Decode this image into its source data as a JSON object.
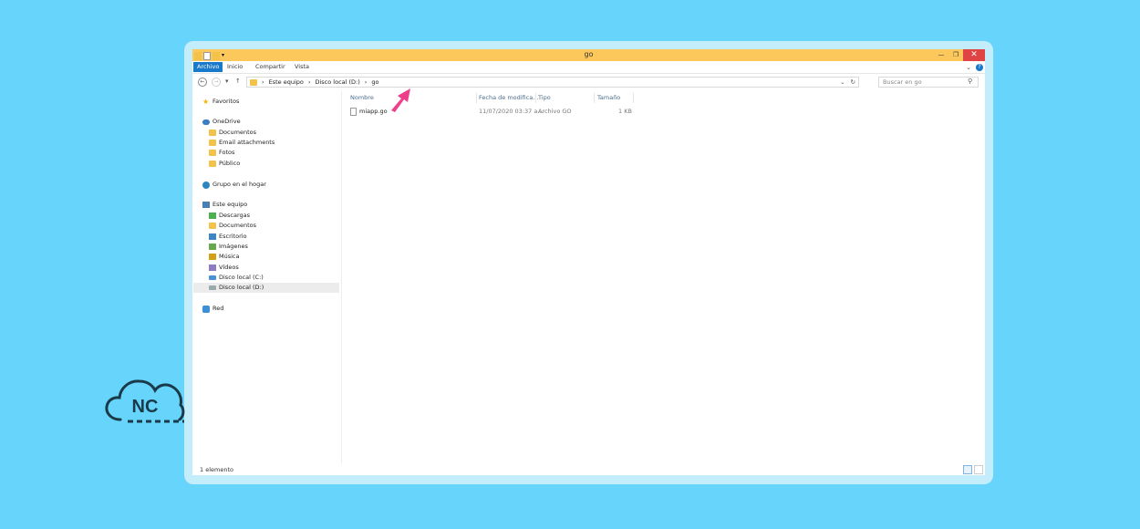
{
  "window": {
    "title": "go",
    "minimize_glyph": "—",
    "maximize_glyph": "❐",
    "close_glyph": "✕"
  },
  "ribbon": {
    "tabs": [
      {
        "label": "Archivo",
        "active": true
      },
      {
        "label": "Inicio",
        "active": false
      },
      {
        "label": "Compartir",
        "active": false
      },
      {
        "label": "Vista",
        "active": false
      }
    ],
    "expand_glyph": "⌄",
    "help_glyph": "?"
  },
  "address": {
    "back_glyph": "←",
    "forward_glyph": "→",
    "recent_glyph": "▾",
    "up_glyph": "↑",
    "breadcrumb": [
      "Este equipo",
      "Disco local (D:)",
      "go"
    ],
    "separator": "›",
    "dropdown_glyph": "⌄",
    "refresh_glyph": "↻"
  },
  "search": {
    "placeholder": "Buscar en go",
    "icon_glyph": "⚲"
  },
  "navpane": {
    "favorites": "Favoritos",
    "onedrive": "OneDrive",
    "onedrive_items": [
      "Documentos",
      "Email attachments",
      "Fotos",
      "Público"
    ],
    "homegroup": "Grupo en el hogar",
    "thispc": "Este equipo",
    "thispc_items": [
      "Descargas",
      "Documentos",
      "Escritorio",
      "Imágenes",
      "Música",
      "Vídeos",
      "Disco local (C:)",
      "Disco local (D:)"
    ],
    "network": "Red",
    "selected": "Disco local (D:)"
  },
  "filelist": {
    "columns": [
      "Nombre",
      "Fecha de modifica...",
      "Tipo",
      "Tamaño"
    ],
    "rows": [
      {
        "name": "miapp.go",
        "date": "11/07/2020 03:37 a...",
        "type": "Archivo GO",
        "size": "1 KB"
      }
    ]
  },
  "status": {
    "count": "1 elemento"
  },
  "colors": {
    "background": "#66d4fb",
    "titlebar": "#fdc85b",
    "accent": "#1979ca",
    "close": "#e04343",
    "arrow": "#ee3f8c",
    "logo": "#1a3a4a"
  },
  "logo": {
    "text": "NC"
  }
}
